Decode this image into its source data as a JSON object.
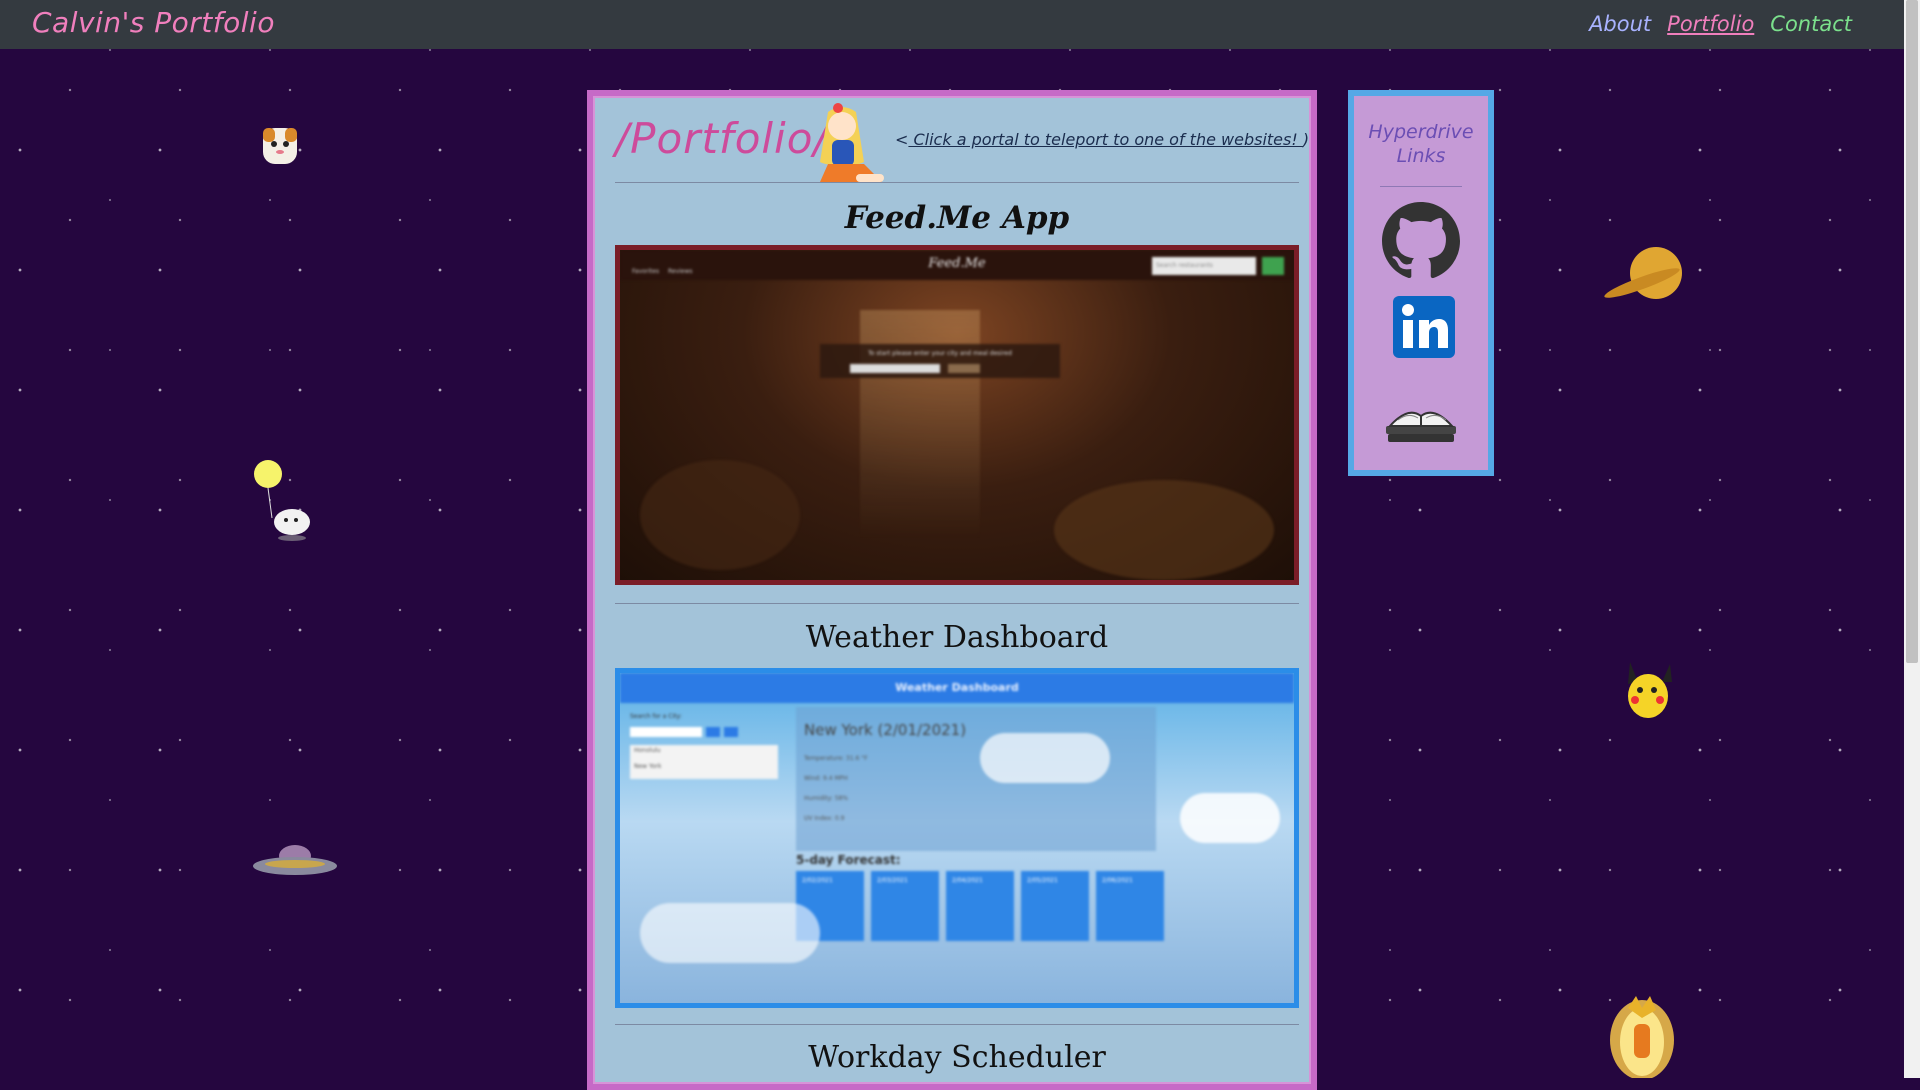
{
  "navbar": {
    "brand": "Calvin's Portfolio",
    "links": [
      {
        "label": "About"
      },
      {
        "label": "Portfolio"
      },
      {
        "label": "Contact"
      }
    ]
  },
  "portfolio": {
    "title": "/Portfolio/",
    "portal_hint_prefix": "<",
    "portal_hint": " Click a portal to teleport to one of the websites! ",
    "portal_hint_suffix": ")",
    "projects": [
      {
        "title": "Feed.Me App",
        "screenshot": {
          "app_name": "Feed.Me",
          "prompt": "To start please enter your city and meal desired",
          "nav_icons": [
            "Favorites",
            "Reviews"
          ],
          "search_placeholder": "Search restaurants"
        }
      },
      {
        "title": "Weather Dashboard",
        "screenshot": {
          "header": "Weather Dashboard",
          "search_label": "Search for a City:",
          "history": [
            "Honolulu",
            "New York"
          ],
          "city_heading": "New York (2/01/2021)",
          "details": [
            "Temperature: 31.6 °F",
            "Wind: 9.4 MPH",
            "Humidity: 58%",
            "UV Index: 0.9"
          ],
          "forecast_title": "5-day Forecast:",
          "forecast_days": [
            "2/02/2021",
            "2/03/2021",
            "2/04/2021",
            "2/05/2021",
            "2/06/2021"
          ]
        }
      },
      {
        "title": "Workday Scheduler"
      }
    ]
  },
  "sidebar": {
    "title": "Hyperdrive Links",
    "links": [
      {
        "icon": "github-icon"
      },
      {
        "icon": "linkedin-icon"
      },
      {
        "icon": "book-icon"
      }
    ]
  },
  "colors": {
    "background": "#25063f",
    "card": "#a3c3d9",
    "card_border": "#c66ac7",
    "sidebar": "#c59ad6",
    "sidebar_border": "#55a8e6",
    "accent_pink": "#f07fbd"
  }
}
